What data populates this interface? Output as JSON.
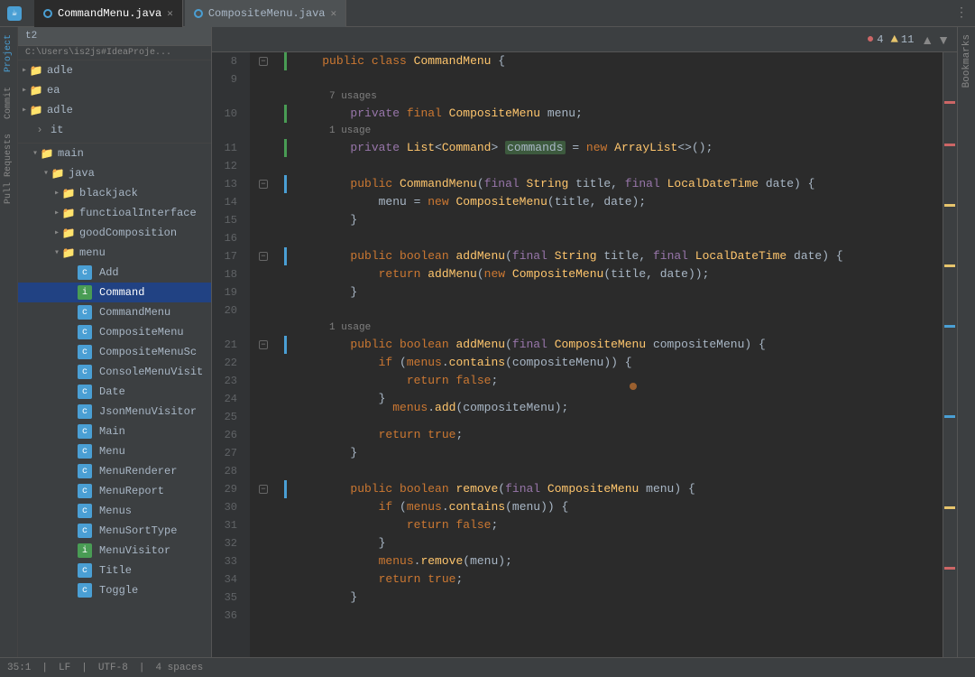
{
  "titlebar": {
    "tabs": [
      {
        "label": "CommandMenu.java",
        "active": true,
        "icon": "java"
      },
      {
        "label": "CompositeMenu.java",
        "active": false,
        "icon": "java"
      }
    ],
    "menu_icon": "≡"
  },
  "project": {
    "name": "t2",
    "path": "C:\\Users\\is2js#IdeaProje...",
    "tree": [
      {
        "label": "adle",
        "level": 0,
        "type": "folder",
        "expanded": false
      },
      {
        "label": "ea",
        "level": 0,
        "type": "folder",
        "expanded": false
      },
      {
        "label": "adle",
        "level": 0,
        "type": "folder",
        "expanded": false
      },
      {
        "label": "it",
        "level": 0,
        "type": "item",
        "expanded": false
      },
      {
        "label": "main",
        "level": 1,
        "type": "folder",
        "expanded": true
      },
      {
        "label": "java",
        "level": 2,
        "type": "folder",
        "expanded": true
      },
      {
        "label": "blackjack",
        "level": 3,
        "type": "folder",
        "expanded": false
      },
      {
        "label": "functioalInterface",
        "level": 3,
        "type": "folder",
        "expanded": false
      },
      {
        "label": "goodComposition",
        "level": 3,
        "type": "folder",
        "expanded": false
      },
      {
        "label": "menu",
        "level": 3,
        "type": "folder",
        "expanded": true
      },
      {
        "label": "Add",
        "level": 4,
        "type": "class",
        "expanded": false
      },
      {
        "label": "Command",
        "level": 4,
        "type": "interface",
        "expanded": false,
        "selected": true
      },
      {
        "label": "CommandMenu",
        "level": 4,
        "type": "class",
        "expanded": false
      },
      {
        "label": "CompositeMenu",
        "level": 4,
        "type": "class",
        "expanded": false
      },
      {
        "label": "CompositeMenuSc",
        "level": 4,
        "type": "class",
        "expanded": false
      },
      {
        "label": "ConsoleMenuVisit",
        "level": 4,
        "type": "class",
        "expanded": false
      },
      {
        "label": "Date",
        "level": 4,
        "type": "class",
        "expanded": false
      },
      {
        "label": "JsonMenuVisitor",
        "level": 4,
        "type": "class",
        "expanded": false
      },
      {
        "label": "Main",
        "level": 4,
        "type": "class",
        "expanded": false
      },
      {
        "label": "Menu",
        "level": 4,
        "type": "class",
        "expanded": false
      },
      {
        "label": "MenuRenderer",
        "level": 4,
        "type": "class",
        "expanded": false
      },
      {
        "label": "MenuReport",
        "level": 4,
        "type": "class",
        "expanded": false
      },
      {
        "label": "Menus",
        "level": 4,
        "type": "class",
        "expanded": false
      },
      {
        "label": "MenuSortType",
        "level": 4,
        "type": "class",
        "expanded": false
      },
      {
        "label": "MenuVisitor",
        "level": 4,
        "type": "interface",
        "expanded": false
      },
      {
        "label": "Title",
        "level": 4,
        "type": "class",
        "expanded": false
      },
      {
        "label": "Toggle",
        "level": 4,
        "type": "class",
        "expanded": false
      }
    ]
  },
  "editor": {
    "error_count": "4",
    "warn_count": "11",
    "indicators": {
      "error_label": "4",
      "warn_label": "11"
    }
  },
  "code": {
    "lines": [
      {
        "num": "8",
        "content": "    public class CommandMenu {",
        "tokens": [
          {
            "t": "    ",
            "c": ""
          },
          {
            "t": "public",
            "c": "kw"
          },
          {
            "t": " ",
            "c": ""
          },
          {
            "t": "class",
            "c": "kw"
          },
          {
            "t": " ",
            "c": ""
          },
          {
            "t": "CommandMenu",
            "c": "class-name"
          },
          {
            "t": " {",
            "c": ""
          }
        ]
      },
      {
        "num": "9",
        "content": ""
      },
      {
        "num": "10",
        "content": "        private final CompositeMenu menu;",
        "usage": "7 usages"
      },
      {
        "num": "11",
        "content": "        private List<Command> commands = new ArrayList<>();",
        "usage": "1 usage"
      },
      {
        "num": "12",
        "content": ""
      },
      {
        "num": "13",
        "content": "        public CommandMenu(final String title, final LocalDateTime date) {"
      },
      {
        "num": "14",
        "content": "            menu = new CompositeMenu(title, date);"
      },
      {
        "num": "15",
        "content": "        }"
      },
      {
        "num": "16",
        "content": ""
      },
      {
        "num": "17",
        "content": "        public boolean addMenu(final String title, final LocalDateTime date) {"
      },
      {
        "num": "18",
        "content": "            return addMenu(new CompositeMenu(title, date));"
      },
      {
        "num": "19",
        "content": "        }"
      },
      {
        "num": "20",
        "content": ""
      },
      {
        "num": "21",
        "content": "        public boolean addMenu(final CompositeMenu compositeMenu) {",
        "usage": "1 usage"
      },
      {
        "num": "22",
        "content": "            if (menus.contains(compositeMenu)) {"
      },
      {
        "num": "23",
        "content": "                return false;"
      },
      {
        "num": "24",
        "content": "            }"
      },
      {
        "num": "25",
        "content": "            menus.add(compositeMenu);"
      },
      {
        "num": "26",
        "content": "            return true;"
      },
      {
        "num": "27",
        "content": "        }"
      },
      {
        "num": "28",
        "content": ""
      },
      {
        "num": "29",
        "content": "        public boolean remove(final CompositeMenu menu) {"
      },
      {
        "num": "30",
        "content": "            if (menus.contains(menu)) {"
      },
      {
        "num": "31",
        "content": "                return false;"
      },
      {
        "num": "32",
        "content": "            }"
      },
      {
        "num": "33",
        "content": "            menus.remove(menu);"
      },
      {
        "num": "34",
        "content": "            return true;"
      },
      {
        "num": "35",
        "content": "        }"
      },
      {
        "num": "36",
        "content": ""
      }
    ]
  },
  "sidebar": {
    "left_tabs": [
      "Project",
      "Commit",
      "Pull Requests"
    ],
    "right_tabs": [
      "Bookmarks"
    ]
  },
  "statusbar": {
    "line_col": "35:1",
    "encoding": "UTF-8",
    "line_endings": "LF",
    "indent": "4 spaces"
  }
}
